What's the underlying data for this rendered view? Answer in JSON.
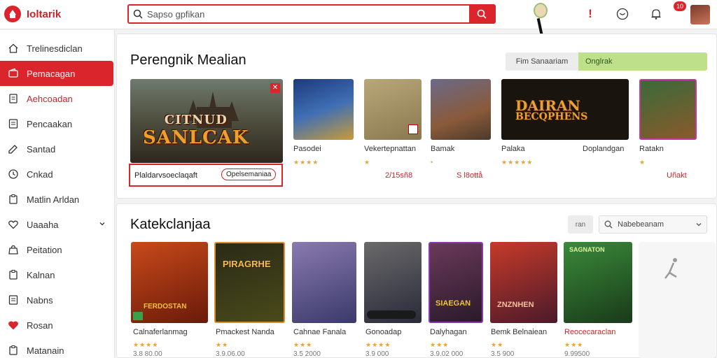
{
  "app": {
    "name": "Ioltarik"
  },
  "search": {
    "placeholder": "Sapso gpfikan"
  },
  "header": {
    "notification_count": "10"
  },
  "sidebar": {
    "items": [
      {
        "label": "Trelinesdiclan",
        "icon": "home-icon"
      },
      {
        "label": "Pemacagan",
        "icon": "wallet-icon"
      },
      {
        "label": "Aehcoadan",
        "icon": "document-icon"
      },
      {
        "label": "Pencaakan",
        "icon": "list-icon"
      },
      {
        "label": "Santad",
        "icon": "edit-icon"
      },
      {
        "label": "Cnkad",
        "icon": "clock-icon"
      },
      {
        "label": "Matlin Arldan",
        "icon": "clipboard-icon"
      },
      {
        "label": "Uaaaha",
        "icon": "heart-icon"
      },
      {
        "label": "Peitation",
        "icon": "bag-icon"
      },
      {
        "label": "Kalnan",
        "icon": "clipboard-icon"
      },
      {
        "label": "Nabns",
        "icon": "list-icon"
      },
      {
        "label": "Rosan",
        "icon": "heart-icon"
      },
      {
        "label": "Matanain",
        "icon": "clipboard-icon"
      }
    ]
  },
  "featured": {
    "title": "Perengnik Mealian",
    "segments": [
      "Fim Sanaariam",
      "Onglrak"
    ],
    "hero": {
      "art_title_line1": "CITNUD",
      "art_title_line2": "SANLCAK",
      "label": "Plaldarvsoeclaqaft",
      "chip": "Opelsemaniaa"
    },
    "games": [
      {
        "name": "Pasodei",
        "stars": "★★★★",
        "price": ""
      },
      {
        "name": "Vekertepnattan",
        "stars": "★",
        "price": "2/15sñ8"
      },
      {
        "name": "Bamak",
        "stars": "•",
        "price": "S l8ottå"
      },
      {
        "name": "Palaka",
        "stars": "★★★★★",
        "price": ""
      },
      {
        "name": "Doplandgan",
        "stars": "",
        "price": ""
      },
      {
        "name": "Ratakn",
        "stars": "★",
        "price": "Uñakt"
      }
    ],
    "card_art": {
      "banner_line1": "DAIRAN",
      "banner_line2": "BECQPHENS"
    }
  },
  "categories": {
    "title": "Katekclanjaa",
    "filter_button": "ran",
    "filter_select": "Nabebeanam",
    "games": [
      {
        "name": "Calnaferlanmag",
        "stars": "★★★★",
        "rating": "3.8 80.00",
        "art": "FERDOSTAN",
        "color": "#8b2a1a"
      },
      {
        "name": "Pmackest Nanda",
        "stars": "★★",
        "rating": "3.9.06.00",
        "art": "PIRAGRHE",
        "color": "#2a3a1a"
      },
      {
        "name": "Cahnae Fanala",
        "stars": "★★★",
        "rating": "3.5 2000",
        "art": "",
        "color": "#4a3a6a"
      },
      {
        "name": "Gonoadap",
        "stars": "★★★★",
        "rating": "3.9 000",
        "art": "",
        "color": "#3a3a4a"
      },
      {
        "name": "Dalyhagan",
        "stars": "★★★",
        "rating": "3.9.02 000",
        "art": "SIAEGAN",
        "color": "#4a2a4a"
      },
      {
        "name": "Bemk Belnaiean",
        "stars": "★★",
        "rating": "3.5 900",
        "art": "ZNZNHEN",
        "color": "#7a1a2a"
      },
      {
        "name": "Reocecaraclan",
        "stars": "★★★",
        "rating": "9.99500",
        "art": "SAGNATON",
        "color": "#1a5a2a"
      }
    ]
  },
  "colors": {
    "accent": "#d9252b",
    "segment_active": "#bfe08a",
    "star": "#e8a33a"
  }
}
